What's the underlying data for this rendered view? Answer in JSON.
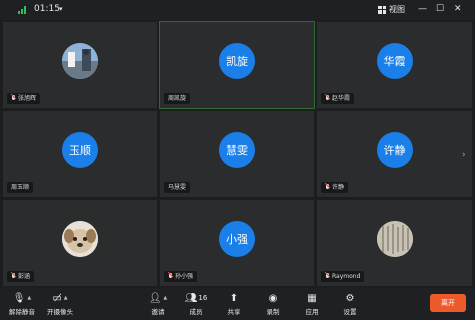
{
  "topbar": {
    "time": "01:15",
    "view_label": "视图",
    "signal_color": "#2ec25a"
  },
  "participants": [
    {
      "name": "张旭辉",
      "avatar_type": "photo"
    },
    {
      "name": "周凯旋",
      "avatar_text": "凯旋",
      "active": true
    },
    {
      "name": "赵华霞",
      "avatar_text": "华霞"
    },
    {
      "name": "周玉顺",
      "avatar_text": "玉顺"
    },
    {
      "name": "马慧雯",
      "avatar_text": "慧雯"
    },
    {
      "name": "许静",
      "avatar_text": "许静"
    },
    {
      "name": "彭涵",
      "avatar_type": "photo"
    },
    {
      "name": "孙小强",
      "avatar_text": "小强"
    },
    {
      "name": "Raymond",
      "avatar_type": "photo"
    }
  ],
  "toolbar": {
    "unmute_label": "解除静音",
    "camera_label": "开摄像头",
    "invite_label": "邀请",
    "members_label": "成员",
    "members_count": "16",
    "share_label": "共享",
    "record_label": "录制",
    "apps_label": "应用",
    "settings_label": "设置",
    "leave_label": "离开"
  },
  "colors": {
    "avatar_blue": "#1a7fe8",
    "leave_orange": "#ec5a2c",
    "active_border": "#2f6b2f"
  }
}
